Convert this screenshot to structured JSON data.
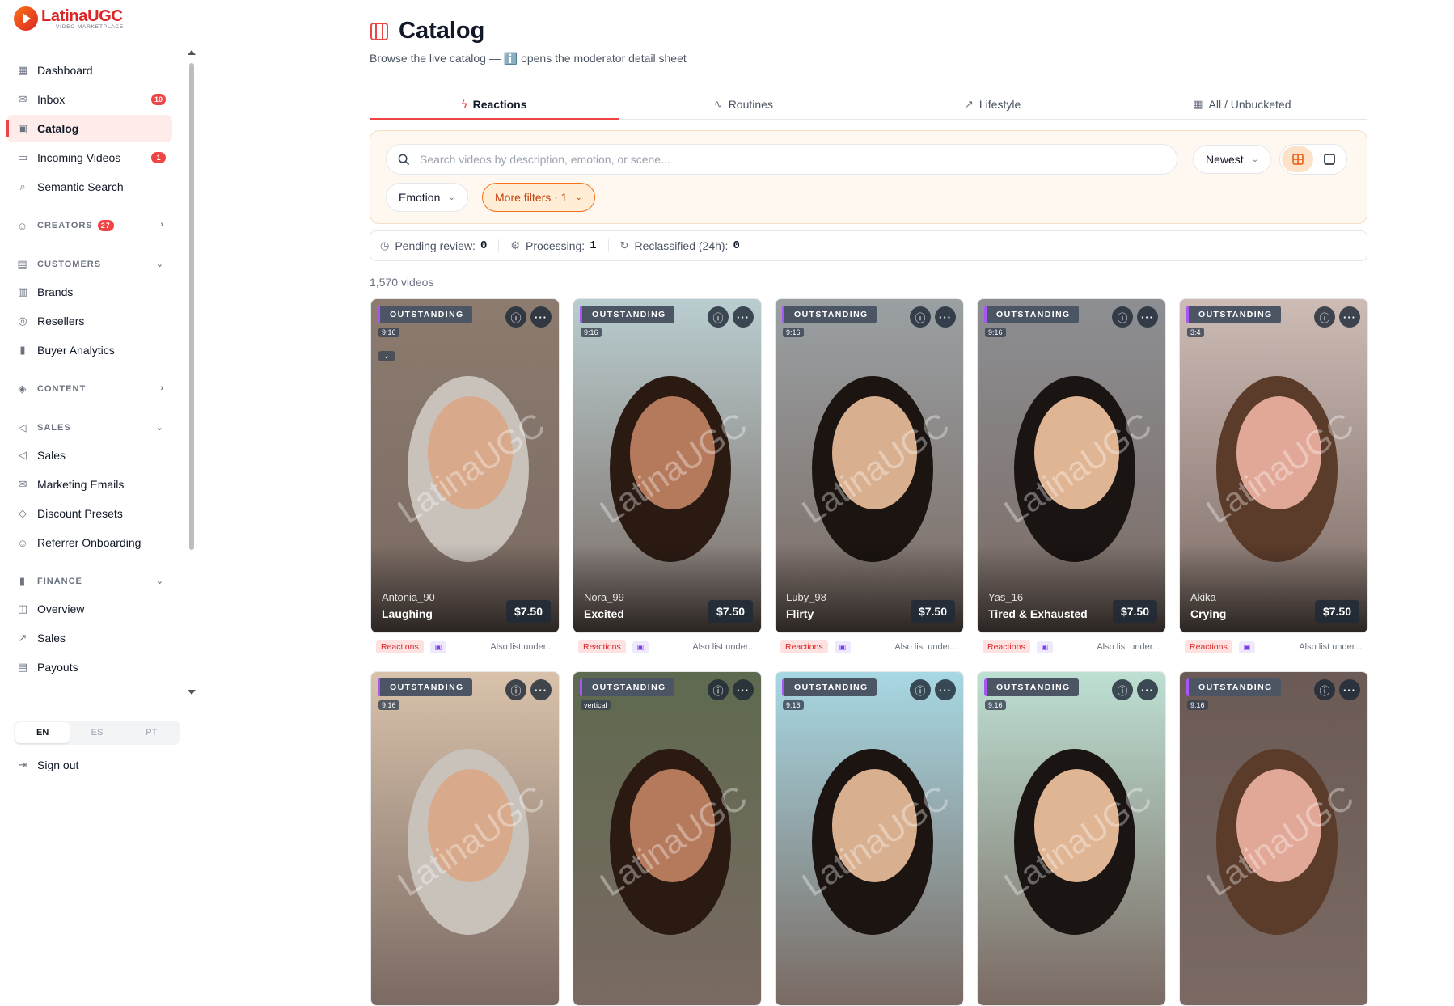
{
  "brand": {
    "name": "LatinaUGC",
    "tagline": "VIDEO MARKETPLACE"
  },
  "nav": {
    "items": [
      {
        "label": "Dashboard",
        "icon": "grid-icon"
      },
      {
        "label": "Inbox",
        "icon": "inbox-icon",
        "badge": "10"
      },
      {
        "label": "Catalog",
        "icon": "film-icon",
        "active": true
      },
      {
        "label": "Incoming Videos",
        "icon": "video-icon",
        "badge": "1"
      },
      {
        "label": "Semantic Search",
        "icon": "search-icon"
      }
    ],
    "creators": {
      "label": "CREATORS",
      "badge": "27"
    },
    "customers": {
      "label": "CUSTOMERS",
      "items": [
        "Brands",
        "Resellers",
        "Buyer Analytics"
      ]
    },
    "content": {
      "label": "CONTENT"
    },
    "sales": {
      "label": "SALES",
      "items": [
        "Sales",
        "Marketing Emails",
        "Discount Presets",
        "Referrer Onboarding"
      ]
    },
    "finance": {
      "label": "FINANCE",
      "items": [
        "Overview",
        "Sales",
        "Payouts"
      ]
    }
  },
  "lang": {
    "options": [
      "EN",
      "ES",
      "PT"
    ],
    "selected": "EN"
  },
  "signout": "Sign out",
  "page": {
    "title": "Catalog",
    "subtitle": "Browse the live catalog — ℹ️ opens the moderator detail sheet"
  },
  "tabs": [
    {
      "label": "Reactions",
      "icon": "zap-icon",
      "active": true
    },
    {
      "label": "Routines",
      "icon": "activity-icon"
    },
    {
      "label": "Lifestyle",
      "icon": "trending-icon"
    },
    {
      "label": "All / Unbucketed",
      "icon": "grid-icon"
    }
  ],
  "filters": {
    "search_placeholder": "Search videos by description, emotion, or scene...",
    "sort": "Newest",
    "emotion": "Emotion",
    "more": "More filters · 1"
  },
  "stats": {
    "pending_label": "Pending review:",
    "pending": "0",
    "processing_label": "Processing:",
    "processing": "1",
    "reclassified_label": "Reclassified (24h):",
    "reclassified": "0"
  },
  "video_count": "1,570 videos",
  "cards_row1": [
    {
      "tag": "OUTSTANDING",
      "ratio": "9:16",
      "creator": "Antonia_90",
      "emotion": "Laughing",
      "price": "$7.50",
      "chip": "Reactions",
      "also": "Also list under...",
      "bg": "#8c7b6e"
    },
    {
      "tag": "OUTSTANDING",
      "ratio": "9:16",
      "creator": "Nora_99",
      "emotion": "Excited",
      "price": "$7.50",
      "chip": "Reactions",
      "also": "Also list under...",
      "bg": "#b9cdd0"
    },
    {
      "tag": "OUTSTANDING",
      "ratio": "9:16",
      "creator": "Luby_98",
      "emotion": "Flirty",
      "price": "$7.50",
      "chip": "Reactions",
      "also": "Also list under...",
      "bg": "#9aa0a3"
    },
    {
      "tag": "OUTSTANDING",
      "ratio": "9:16",
      "creator": "Yas_16",
      "emotion": "Tired & Exhausted",
      "price": "$7.50",
      "chip": "Reactions",
      "also": "Also list under...",
      "bg": "#8d8f93"
    },
    {
      "tag": "OUTSTANDING",
      "ratio": "3:4",
      "creator": "Akika",
      "emotion": "Crying",
      "price": "$7.50",
      "chip": "Reactions",
      "also": "Also list under...",
      "bg": "#cdbcb5"
    }
  ],
  "cards_row2": [
    {
      "tag": "OUTSTANDING",
      "ratio": "9:16",
      "bg": "#d9c2ab"
    },
    {
      "tag": "OUTSTANDING",
      "ratio": "vertical",
      "bg": "#5e6a4f"
    },
    {
      "tag": "OUTSTANDING",
      "ratio": "9:16",
      "bg": "#a7d8e4"
    },
    {
      "tag": "OUTSTANDING",
      "ratio": "9:16",
      "bg": "#bde0d2"
    },
    {
      "tag": "OUTSTANDING",
      "ratio": "9:16",
      "bg": "#6b5a55"
    }
  ],
  "watermark": "LatinaUGC"
}
